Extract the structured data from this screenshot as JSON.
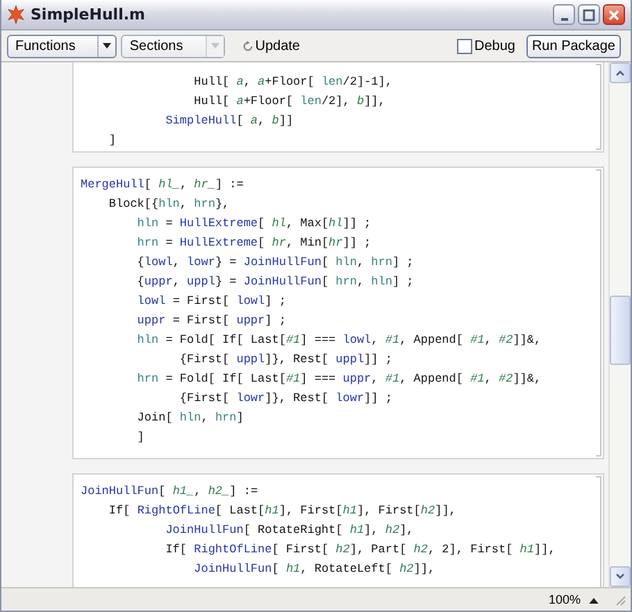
{
  "window": {
    "title": "SimpleHull.m"
  },
  "toolbar": {
    "menus": [
      {
        "label": "Functions",
        "disabled": false
      },
      {
        "label": "Sections",
        "disabled": true
      }
    ],
    "update_button": {
      "label": "Update"
    },
    "debug": {
      "label": "Debug",
      "checked": false
    },
    "run_button": {
      "label": "Run Package"
    }
  },
  "cells": [
    {
      "lines": [
        [
          {
            "text": "                Hull[ ",
            "kind": "plain"
          },
          {
            "text": "a",
            "kind": "arg"
          },
          {
            "text": ", ",
            "kind": "plain"
          },
          {
            "text": "a",
            "kind": "arg"
          },
          {
            "text": "+Floor[ ",
            "kind": "plain"
          },
          {
            "text": "len",
            "kind": "local"
          },
          {
            "text": "/2]-1],",
            "kind": "plain"
          }
        ],
        [
          {
            "text": "                Hull[ ",
            "kind": "plain"
          },
          {
            "text": "a",
            "kind": "arg"
          },
          {
            "text": "+Floor[ ",
            "kind": "plain"
          },
          {
            "text": "len",
            "kind": "local"
          },
          {
            "text": "/2], ",
            "kind": "plain"
          },
          {
            "text": "b",
            "kind": "arg"
          },
          {
            "text": "]],",
            "kind": "plain"
          }
        ],
        [
          {
            "text": "            SimpleHull",
            "kind": "global"
          },
          {
            "text": "[ ",
            "kind": "plain"
          },
          {
            "text": "a",
            "kind": "arg"
          },
          {
            "text": ", ",
            "kind": "plain"
          },
          {
            "text": "b",
            "kind": "arg"
          },
          {
            "text": "]]",
            "kind": "plain"
          }
        ],
        [
          {
            "text": "    ]",
            "kind": "plain"
          }
        ]
      ]
    },
    {
      "lines": [
        [
          {
            "text": "MergeHull",
            "kind": "global"
          },
          {
            "text": "[ ",
            "kind": "plain"
          },
          {
            "text": "hl_",
            "kind": "arg"
          },
          {
            "text": ", ",
            "kind": "plain"
          },
          {
            "text": "hr_",
            "kind": "arg"
          },
          {
            "text": "] :=",
            "kind": "plain"
          }
        ],
        [
          {
            "text": "    Block[{",
            "kind": "plain"
          },
          {
            "text": "hln",
            "kind": "local"
          },
          {
            "text": ", ",
            "kind": "plain"
          },
          {
            "text": "hrn",
            "kind": "local"
          },
          {
            "text": "},",
            "kind": "plain"
          }
        ],
        [
          {
            "text": "        hln",
            "kind": "local"
          },
          {
            "text": " = ",
            "kind": "plain"
          },
          {
            "text": "HullExtreme",
            "kind": "global"
          },
          {
            "text": "[ ",
            "kind": "plain"
          },
          {
            "text": "hl",
            "kind": "arg"
          },
          {
            "text": ", Max[",
            "kind": "plain"
          },
          {
            "text": "hl",
            "kind": "arg"
          },
          {
            "text": "]] ;",
            "kind": "plain"
          }
        ],
        [
          {
            "text": "        hrn",
            "kind": "local"
          },
          {
            "text": " = ",
            "kind": "plain"
          },
          {
            "text": "HullExtreme",
            "kind": "global"
          },
          {
            "text": "[ ",
            "kind": "plain"
          },
          {
            "text": "hr",
            "kind": "arg"
          },
          {
            "text": ", Min[",
            "kind": "plain"
          },
          {
            "text": "hr",
            "kind": "arg"
          },
          {
            "text": "]] ;",
            "kind": "plain"
          }
        ],
        [
          {
            "text": "        {",
            "kind": "plain"
          },
          {
            "text": "lowl",
            "kind": "global"
          },
          {
            "text": ", ",
            "kind": "plain"
          },
          {
            "text": "lowr",
            "kind": "global"
          },
          {
            "text": "} = ",
            "kind": "plain"
          },
          {
            "text": "JoinHullFun",
            "kind": "global"
          },
          {
            "text": "[ ",
            "kind": "plain"
          },
          {
            "text": "hln",
            "kind": "local"
          },
          {
            "text": ", ",
            "kind": "plain"
          },
          {
            "text": "hrn",
            "kind": "local"
          },
          {
            "text": "] ;",
            "kind": "plain"
          }
        ],
        [
          {
            "text": "        {",
            "kind": "plain"
          },
          {
            "text": "uppr",
            "kind": "global"
          },
          {
            "text": ", ",
            "kind": "plain"
          },
          {
            "text": "uppl",
            "kind": "global"
          },
          {
            "text": "} = ",
            "kind": "plain"
          },
          {
            "text": "JoinHullFun",
            "kind": "global"
          },
          {
            "text": "[ ",
            "kind": "plain"
          },
          {
            "text": "hrn",
            "kind": "local"
          },
          {
            "text": ", ",
            "kind": "plain"
          },
          {
            "text": "hln",
            "kind": "local"
          },
          {
            "text": "] ;",
            "kind": "plain"
          }
        ],
        [
          {
            "text": "        lowl",
            "kind": "global"
          },
          {
            "text": " = First[ ",
            "kind": "plain"
          },
          {
            "text": "lowl",
            "kind": "global"
          },
          {
            "text": "] ;",
            "kind": "plain"
          }
        ],
        [
          {
            "text": "        uppr",
            "kind": "global"
          },
          {
            "text": " = First[ ",
            "kind": "plain"
          },
          {
            "text": "uppr",
            "kind": "global"
          },
          {
            "text": "] ;",
            "kind": "plain"
          }
        ],
        [
          {
            "text": "        hln",
            "kind": "local"
          },
          {
            "text": " = Fold[ If[ Last[",
            "kind": "plain"
          },
          {
            "text": "#1",
            "kind": "arg"
          },
          {
            "text": "] === ",
            "kind": "plain"
          },
          {
            "text": "lowl",
            "kind": "global"
          },
          {
            "text": ", ",
            "kind": "plain"
          },
          {
            "text": "#1",
            "kind": "arg"
          },
          {
            "text": ", Append[ ",
            "kind": "plain"
          },
          {
            "text": "#1",
            "kind": "arg"
          },
          {
            "text": ", ",
            "kind": "plain"
          },
          {
            "text": "#2",
            "kind": "arg"
          },
          {
            "text": "]]&,",
            "kind": "plain"
          }
        ],
        [
          {
            "text": "              {First[ ",
            "kind": "plain"
          },
          {
            "text": "uppl",
            "kind": "global"
          },
          {
            "text": "]}, Rest[ ",
            "kind": "plain"
          },
          {
            "text": "uppl",
            "kind": "global"
          },
          {
            "text": "]] ;",
            "kind": "plain"
          }
        ],
        [
          {
            "text": "        hrn",
            "kind": "local"
          },
          {
            "text": " = Fold[ If[ Last[",
            "kind": "plain"
          },
          {
            "text": "#1",
            "kind": "arg"
          },
          {
            "text": "] === ",
            "kind": "plain"
          },
          {
            "text": "uppr",
            "kind": "global"
          },
          {
            "text": ", ",
            "kind": "plain"
          },
          {
            "text": "#1",
            "kind": "arg"
          },
          {
            "text": ", Append[ ",
            "kind": "plain"
          },
          {
            "text": "#1",
            "kind": "arg"
          },
          {
            "text": ", ",
            "kind": "plain"
          },
          {
            "text": "#2",
            "kind": "arg"
          },
          {
            "text": "]]&,",
            "kind": "plain"
          }
        ],
        [
          {
            "text": "              {First[ ",
            "kind": "plain"
          },
          {
            "text": "lowr",
            "kind": "global"
          },
          {
            "text": "]}, Rest[ ",
            "kind": "plain"
          },
          {
            "text": "lowr",
            "kind": "global"
          },
          {
            "text": "]] ;",
            "kind": "plain"
          }
        ],
        [
          {
            "text": "        Join[ ",
            "kind": "plain"
          },
          {
            "text": "hln",
            "kind": "local"
          },
          {
            "text": ", ",
            "kind": "plain"
          },
          {
            "text": "hrn",
            "kind": "local"
          },
          {
            "text": "]",
            "kind": "plain"
          }
        ],
        [
          {
            "text": "        ]",
            "kind": "plain"
          }
        ]
      ]
    },
    {
      "lines": [
        [
          {
            "text": "JoinHullFun",
            "kind": "global"
          },
          {
            "text": "[ ",
            "kind": "plain"
          },
          {
            "text": "h1_",
            "kind": "arg"
          },
          {
            "text": ", ",
            "kind": "plain"
          },
          {
            "text": "h2_",
            "kind": "arg"
          },
          {
            "text": "] :=",
            "kind": "plain"
          }
        ],
        [
          {
            "text": "    If[ ",
            "kind": "plain"
          },
          {
            "text": "RightOfLine",
            "kind": "global"
          },
          {
            "text": "[ Last[",
            "kind": "plain"
          },
          {
            "text": "h1",
            "kind": "arg"
          },
          {
            "text": "], First[",
            "kind": "plain"
          },
          {
            "text": "h1",
            "kind": "arg"
          },
          {
            "text": "], First[",
            "kind": "plain"
          },
          {
            "text": "h2",
            "kind": "arg"
          },
          {
            "text": "]],",
            "kind": "plain"
          }
        ],
        [
          {
            "text": "            JoinHullFun",
            "kind": "global"
          },
          {
            "text": "[ RotateRight[ ",
            "kind": "plain"
          },
          {
            "text": "h1",
            "kind": "arg"
          },
          {
            "text": "], ",
            "kind": "plain"
          },
          {
            "text": "h2",
            "kind": "arg"
          },
          {
            "text": "],",
            "kind": "plain"
          }
        ],
        [
          {
            "text": "            If[ ",
            "kind": "plain"
          },
          {
            "text": "RightOfLine",
            "kind": "global"
          },
          {
            "text": "[ First[ ",
            "kind": "plain"
          },
          {
            "text": "h2",
            "kind": "arg"
          },
          {
            "text": "], Part[ ",
            "kind": "plain"
          },
          {
            "text": "h2",
            "kind": "arg"
          },
          {
            "text": ", 2], First[ ",
            "kind": "plain"
          },
          {
            "text": "h1",
            "kind": "arg"
          },
          {
            "text": "]],",
            "kind": "plain"
          }
        ],
        [
          {
            "text": "                JoinHullFun",
            "kind": "global"
          },
          {
            "text": "[ ",
            "kind": "plain"
          },
          {
            "text": "h1",
            "kind": "arg"
          },
          {
            "text": ", RotateLeft[ ",
            "kind": "plain"
          },
          {
            "text": "h2",
            "kind": "arg"
          },
          {
            "text": "]],",
            "kind": "plain"
          }
        ]
      ]
    }
  ],
  "status_bar": {
    "zoom": "100%"
  }
}
